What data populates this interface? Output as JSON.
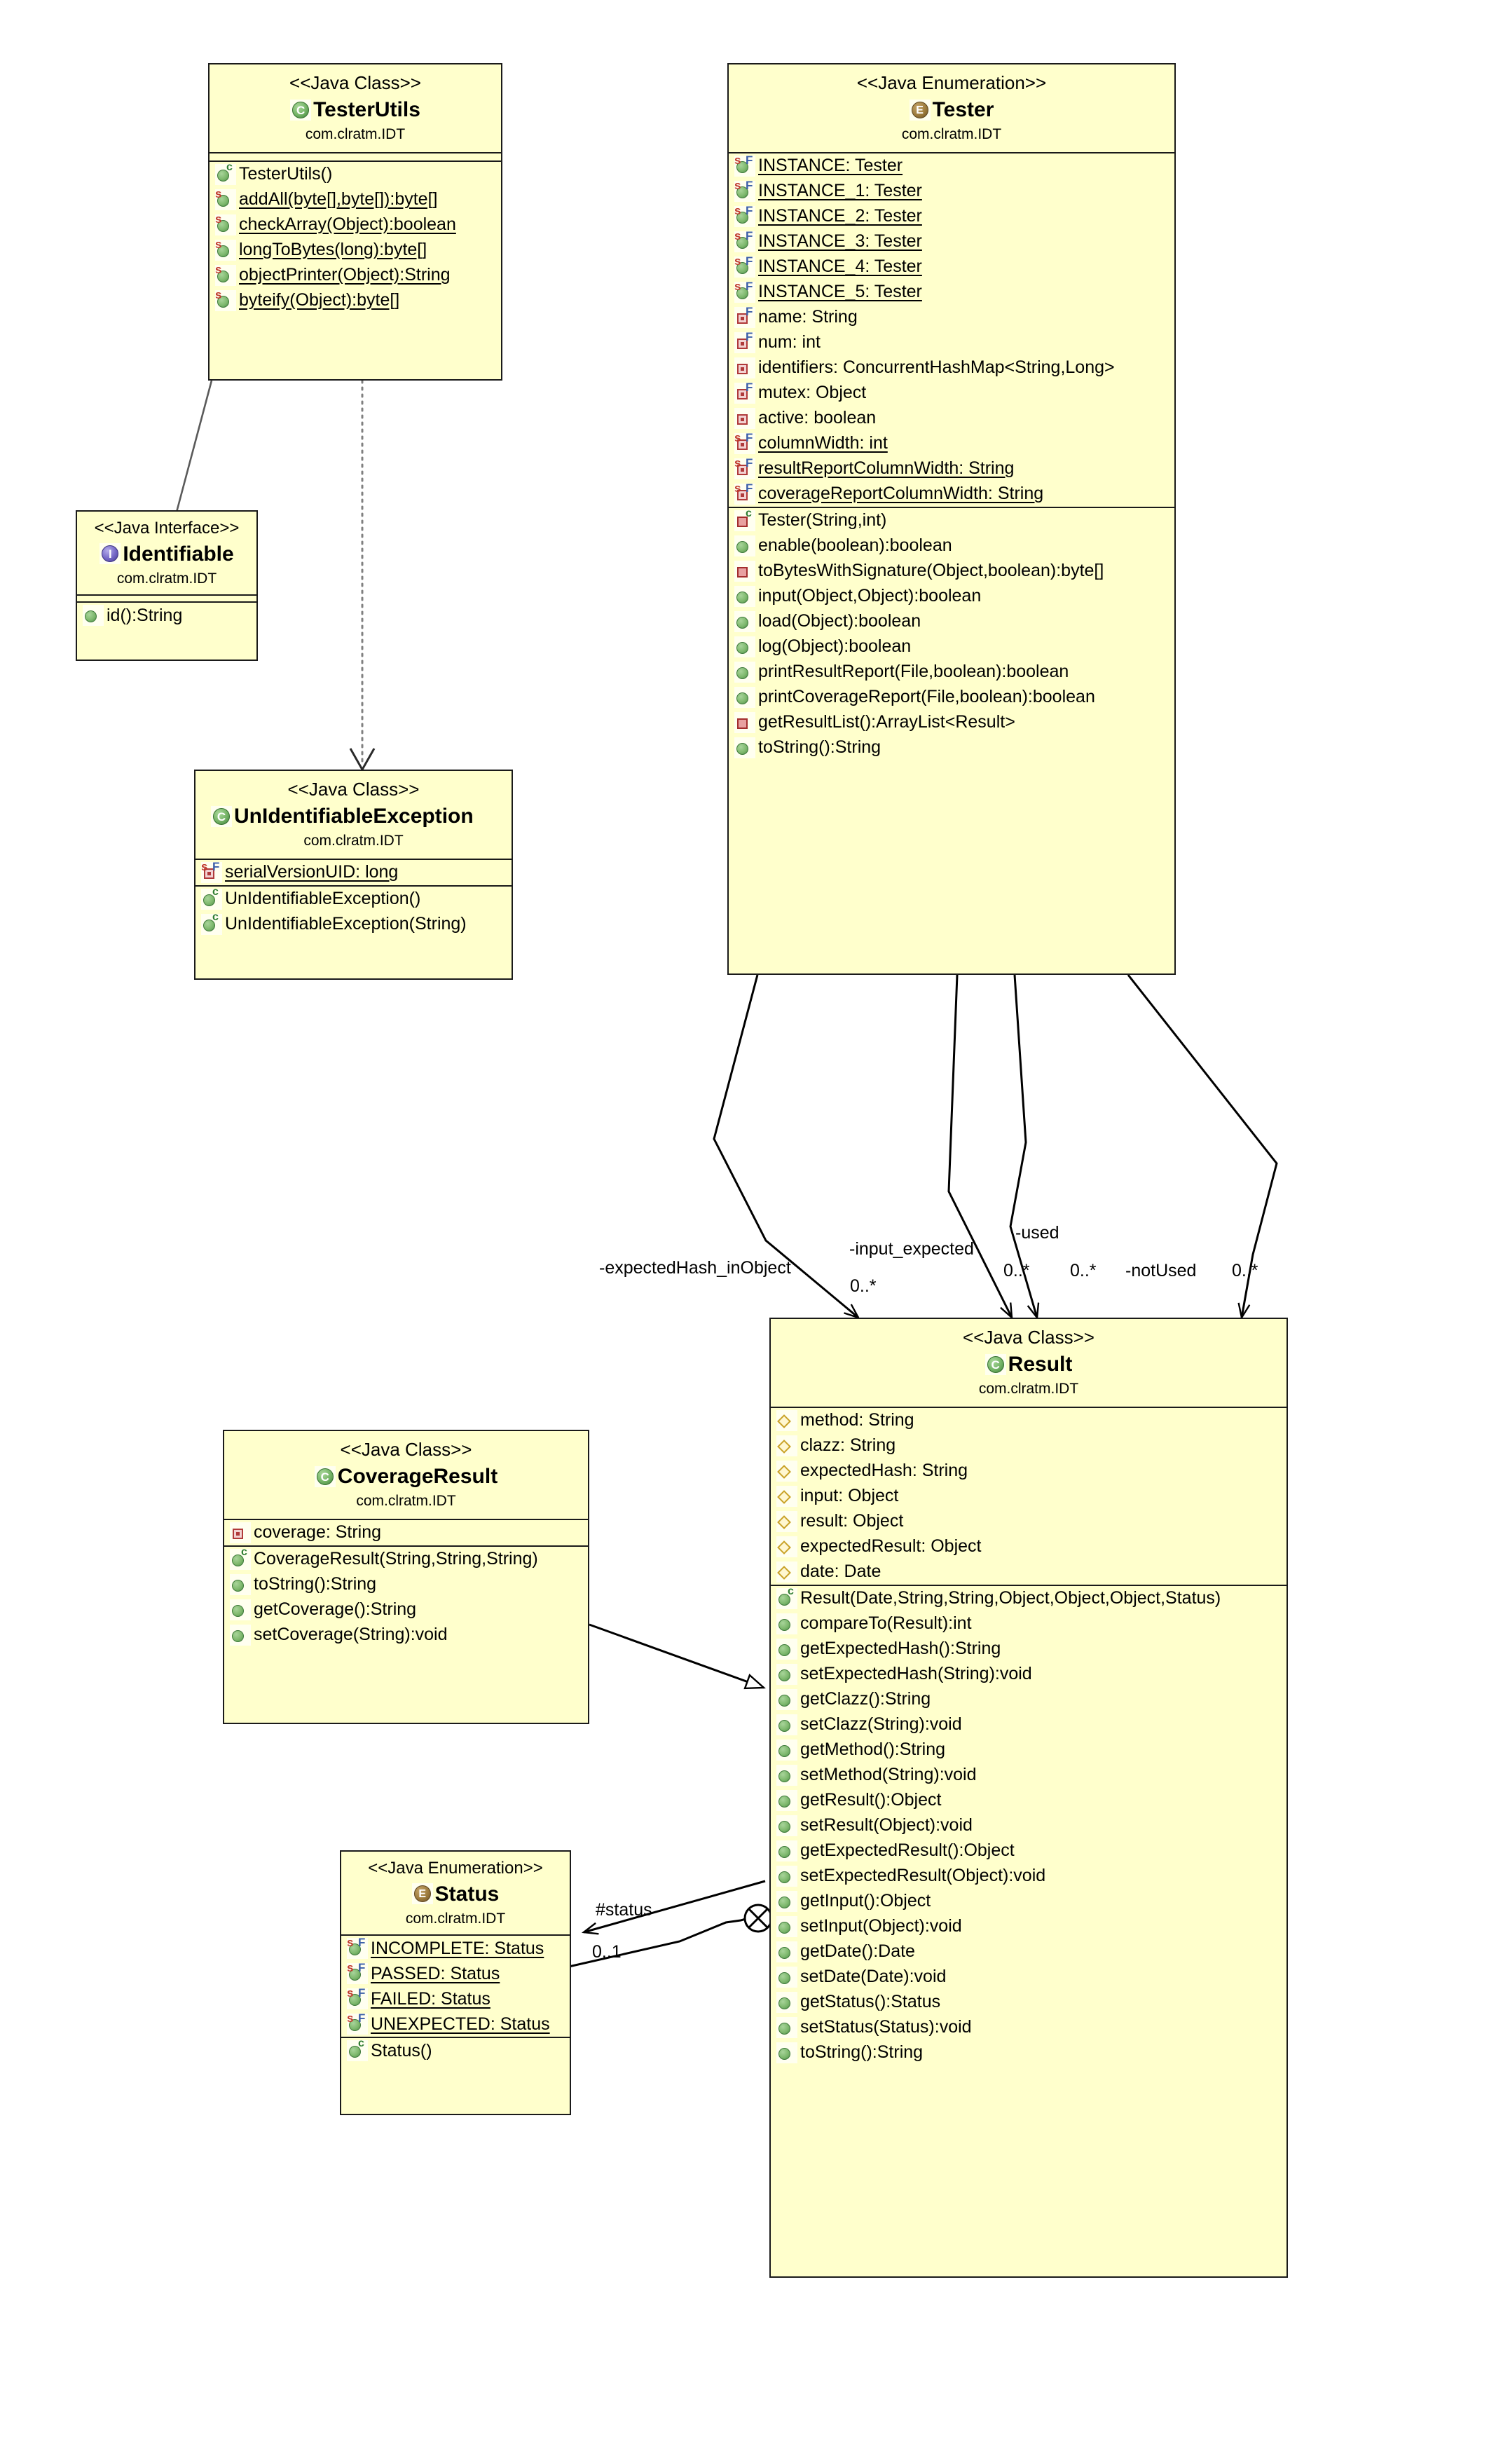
{
  "diagram": {
    "kind": "UML Class Diagram",
    "package": "com.clratm.IDT",
    "colors": {
      "box_fill": "#ffffcc",
      "box_border": "#1a1a1a",
      "canvas": "#ffffff"
    }
  },
  "classes": {
    "tester_utils": {
      "stereotype": "<<Java Class>>",
      "name": "TesterUtils",
      "package": "com.clratm.IDT",
      "icon": "java-class-icon",
      "attributes": [],
      "methods": [
        {
          "text": "TesterUtils()",
          "icon": "public-constructor-icon",
          "static": false
        },
        {
          "text": "addAll(byte[],byte[]):byte[]",
          "icon": "public-static-method-icon",
          "static": true
        },
        {
          "text": "checkArray(Object):boolean",
          "icon": "public-static-method-icon",
          "static": true
        },
        {
          "text": "longToBytes(long):byte[]",
          "icon": "public-static-method-icon",
          "static": true
        },
        {
          "text": "objectPrinter(Object):String",
          "icon": "public-static-method-icon",
          "static": true
        },
        {
          "text": "byteify(Object):byte[]",
          "icon": "public-static-method-icon",
          "static": true
        }
      ]
    },
    "identifiable": {
      "stereotype": "<<Java Interface>>",
      "name": "Identifiable",
      "package": "com.clratm.IDT",
      "icon": "java-interface-icon",
      "attributes": [],
      "methods": [
        {
          "text": "id():String",
          "icon": "public-method-icon",
          "static": false
        }
      ]
    },
    "unidentifiable_exception": {
      "stereotype": "<<Java Class>>",
      "name": "UnIdentifiableException",
      "package": "com.clratm.IDT",
      "icon": "java-class-icon",
      "attributes": [
        {
          "text": "serialVersionUID: long",
          "icon": "private-static-final-field-icon",
          "static": true
        }
      ],
      "methods": [
        {
          "text": "UnIdentifiableException()",
          "icon": "public-constructor-icon",
          "static": false
        },
        {
          "text": "UnIdentifiableException(String)",
          "icon": "public-constructor-icon",
          "static": false
        }
      ]
    },
    "tester": {
      "stereotype": "<<Java Enumeration>>",
      "name": "Tester",
      "package": "com.clratm.IDT",
      "icon": "java-enumeration-icon",
      "attributes": [
        {
          "text": "INSTANCE: Tester",
          "icon": "public-static-final-field-icon",
          "static": true
        },
        {
          "text": "INSTANCE_1: Tester",
          "icon": "public-static-final-field-icon",
          "static": true
        },
        {
          "text": "INSTANCE_2: Tester",
          "icon": "public-static-final-field-icon",
          "static": true
        },
        {
          "text": "INSTANCE_3: Tester",
          "icon": "public-static-final-field-icon",
          "static": true
        },
        {
          "text": "INSTANCE_4: Tester",
          "icon": "public-static-final-field-icon",
          "static": true
        },
        {
          "text": "INSTANCE_5: Tester",
          "icon": "public-static-final-field-icon",
          "static": true
        },
        {
          "text": "name: String",
          "icon": "private-final-field-icon",
          "static": false
        },
        {
          "text": "num: int",
          "icon": "private-final-field-icon",
          "static": false
        },
        {
          "text": "identifiers: ConcurrentHashMap<String,Long>",
          "icon": "private-field-icon",
          "static": false
        },
        {
          "text": "mutex: Object",
          "icon": "private-final-field-icon",
          "static": false
        },
        {
          "text": "active: boolean",
          "icon": "private-field-icon",
          "static": false
        },
        {
          "text": "columnWidth: int",
          "icon": "private-static-final-field-icon",
          "static": true
        },
        {
          "text": "resultReportColumnWidth: String",
          "icon": "private-static-final-field-icon",
          "static": true
        },
        {
          "text": "coverageReportColumnWidth: String",
          "icon": "private-static-final-field-icon",
          "static": true
        }
      ],
      "methods": [
        {
          "text": "Tester(String,int)",
          "icon": "private-constructor-icon",
          "static": false
        },
        {
          "text": "enable(boolean):boolean",
          "icon": "public-method-icon",
          "static": false
        },
        {
          "text": "toBytesWithSignature(Object,boolean):byte[]",
          "icon": "private-method-icon",
          "static": false
        },
        {
          "text": "input(Object,Object):boolean",
          "icon": "public-method-icon",
          "static": false
        },
        {
          "text": "load(Object):boolean",
          "icon": "public-method-icon",
          "static": false
        },
        {
          "text": "log(Object):boolean",
          "icon": "public-method-icon",
          "static": false
        },
        {
          "text": "printResultReport(File,boolean):boolean",
          "icon": "public-method-icon",
          "static": false
        },
        {
          "text": "printCoverageReport(File,boolean):boolean",
          "icon": "public-method-icon",
          "static": false
        },
        {
          "text": "getResultList():ArrayList<Result>",
          "icon": "private-method-icon",
          "static": false
        },
        {
          "text": "toString():String",
          "icon": "public-method-icon",
          "static": false
        }
      ]
    },
    "result": {
      "stereotype": "<<Java Class>>",
      "name": "Result",
      "package": "com.clratm.IDT",
      "icon": "java-class-icon",
      "attributes": [
        {
          "text": "method: String",
          "icon": "package-field-icon",
          "static": false
        },
        {
          "text": "clazz: String",
          "icon": "package-field-icon",
          "static": false
        },
        {
          "text": "expectedHash: String",
          "icon": "package-field-icon",
          "static": false
        },
        {
          "text": "input: Object",
          "icon": "package-field-icon",
          "static": false
        },
        {
          "text": "result: Object",
          "icon": "package-field-icon",
          "static": false
        },
        {
          "text": "expectedResult: Object",
          "icon": "package-field-icon",
          "static": false
        },
        {
          "text": "date: Date",
          "icon": "package-field-icon",
          "static": false
        }
      ],
      "methods": [
        {
          "text": "Result(Date,String,String,Object,Object,Object,Status)",
          "icon": "public-constructor-icon",
          "static": false
        },
        {
          "text": "compareTo(Result):int",
          "icon": "public-method-icon",
          "static": false
        },
        {
          "text": "getExpectedHash():String",
          "icon": "public-method-icon",
          "static": false
        },
        {
          "text": "setExpectedHash(String):void",
          "icon": "public-method-icon",
          "static": false
        },
        {
          "text": "getClazz():String",
          "icon": "public-method-icon",
          "static": false
        },
        {
          "text": "setClazz(String):void",
          "icon": "public-method-icon",
          "static": false
        },
        {
          "text": "getMethod():String",
          "icon": "public-method-icon",
          "static": false
        },
        {
          "text": "setMethod(String):void",
          "icon": "public-method-icon",
          "static": false
        },
        {
          "text": "getResult():Object",
          "icon": "public-method-icon",
          "static": false
        },
        {
          "text": "setResult(Object):void",
          "icon": "public-method-icon",
          "static": false
        },
        {
          "text": "getExpectedResult():Object",
          "icon": "public-method-icon",
          "static": false
        },
        {
          "text": "setExpectedResult(Object):void",
          "icon": "public-method-icon",
          "static": false
        },
        {
          "text": "getInput():Object",
          "icon": "public-method-icon",
          "static": false
        },
        {
          "text": "setInput(Object):void",
          "icon": "public-method-icon",
          "static": false
        },
        {
          "text": "getDate():Date",
          "icon": "public-method-icon",
          "static": false
        },
        {
          "text": "setDate(Date):void",
          "icon": "public-method-icon",
          "static": false
        },
        {
          "text": "getStatus():Status",
          "icon": "public-method-icon",
          "static": false
        },
        {
          "text": "setStatus(Status):void",
          "icon": "public-method-icon",
          "static": false
        },
        {
          "text": "toString():String",
          "icon": "public-method-icon",
          "static": false
        }
      ]
    },
    "coverage_result": {
      "stereotype": "<<Java Class>>",
      "name": "CoverageResult",
      "package": "com.clratm.IDT",
      "icon": "java-class-icon",
      "attributes": [
        {
          "text": "coverage: String",
          "icon": "private-field-icon",
          "static": false
        }
      ],
      "methods": [
        {
          "text": "CoverageResult(String,String,String)",
          "icon": "public-constructor-icon",
          "static": false
        },
        {
          "text": "toString():String",
          "icon": "public-method-icon",
          "static": false
        },
        {
          "text": "getCoverage():String",
          "icon": "public-method-icon",
          "static": false
        },
        {
          "text": "setCoverage(String):void",
          "icon": "public-method-icon",
          "static": false
        }
      ]
    },
    "status": {
      "stereotype": "<<Java Enumeration>>",
      "name": "Status",
      "package": "com.clratm.IDT",
      "icon": "java-enumeration-icon",
      "attributes": [
        {
          "text": "INCOMPLETE: Status",
          "icon": "public-static-final-field-icon",
          "static": true
        },
        {
          "text": "PASSED: Status",
          "icon": "public-static-final-field-icon",
          "static": true
        },
        {
          "text": "FAILED: Status",
          "icon": "public-static-final-field-icon",
          "static": true
        },
        {
          "text": "UNEXPECTED: Status",
          "icon": "public-static-final-field-icon",
          "static": true
        }
      ],
      "methods": [
        {
          "text": "Status()",
          "icon": "public-constructor-icon",
          "static": false
        }
      ]
    }
  },
  "edges": [
    {
      "id": "e1",
      "from": "TesterUtils",
      "to": "Identifiable",
      "type": "dependency"
    },
    {
      "id": "e2",
      "from": "TesterUtils",
      "to": "UnIdentifiableException",
      "type": "dependency"
    },
    {
      "id": "e3",
      "from": "Tester",
      "to": "Result",
      "type": "association",
      "role": "-expectedHash_inObject",
      "multiplicity": "0..*"
    },
    {
      "id": "e4",
      "from": "Tester",
      "to": "Result",
      "type": "association",
      "role": "-input_expected",
      "multiplicity": "0..*"
    },
    {
      "id": "e5",
      "from": "Tester",
      "to": "Result",
      "type": "association",
      "role": "-used",
      "multiplicity": "0..*"
    },
    {
      "id": "e6",
      "from": "Tester",
      "to": "Result",
      "type": "association",
      "role": "-notUsed",
      "multiplicity": "0..*"
    },
    {
      "id": "e7",
      "from": "CoverageResult",
      "to": "Result",
      "type": "generalization"
    },
    {
      "id": "e8",
      "from": "Result",
      "to": "Status",
      "type": "association",
      "role": "#status",
      "multiplicity": "0..1"
    }
  ],
  "edge_labels": {
    "expected_hash_role": "-expectedHash_inObject",
    "expected_hash_mult": "0..*",
    "input_expected_role": "-input_expected",
    "input_expected_mult": "0..*",
    "used_role": "-used",
    "used_mult": "0..*",
    "not_used_role": "-notUsed",
    "not_used_mult": "0..*",
    "status_role": "#status",
    "status_mult": "0..1"
  }
}
